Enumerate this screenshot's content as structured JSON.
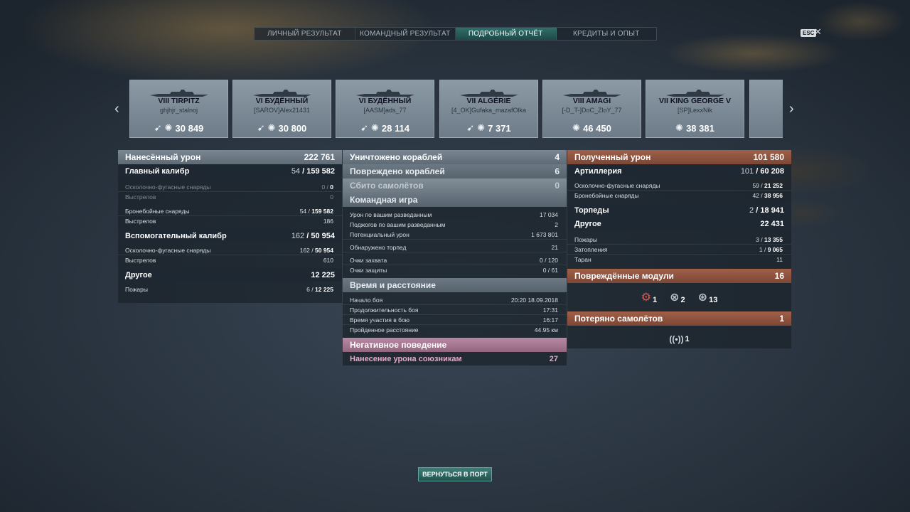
{
  "tabs": [
    {
      "label": "ЛИЧНЫЙ РЕЗУЛЬТАТ",
      "active": false
    },
    {
      "label": "КОМАНДНЫЙ РЕЗУЛЬТАТ",
      "active": false
    },
    {
      "label": "ПОДРОБНЫЙ ОТЧЁТ",
      "active": true
    },
    {
      "label": "КРЕДИТЫ И ОПЫТ",
      "active": false
    }
  ],
  "close": {
    "esc": "ESC",
    "x": "✕"
  },
  "ships": [
    {
      "name": "VIII TIRPITZ",
      "player": "ghjhjr_stalnoj",
      "value": "30 849",
      "torpedo": true
    },
    {
      "name": "VI БУДЁННЫЙ",
      "player": "[SAROV]Alex21431",
      "value": "30 800",
      "torpedo": true
    },
    {
      "name": "VI БУДЁННЫЙ",
      "player": "[AASM]ads_77",
      "value": "28 114",
      "torpedo": true
    },
    {
      "name": "VII ALGÉRIE",
      "player": "[4_OK]Gufaka_mazafOlka",
      "value": "7 371",
      "torpedo": true
    },
    {
      "name": "VIII AMAGI",
      "player": "[-D_T-]DoC_ZloY_77",
      "value": "46 450",
      "torpedo": false
    },
    {
      "name": "VII KING GEORGE V",
      "player": "[SP]LexxNik",
      "value": "38 381",
      "torpedo": false
    }
  ],
  "left": {
    "header": {
      "label": "Нанесённый урон",
      "value": "222 761"
    },
    "main_caliber": {
      "label": "Главный калибр",
      "v1": "54",
      "v2": "159 582"
    },
    "he_shells": {
      "label": "Осколочно-фугасные снаряды",
      "v1": "0",
      "v2": "0"
    },
    "he_shots": {
      "label": "Выстрелов",
      "value": "0"
    },
    "ap_shells": {
      "label": "Бронебойные снаряды",
      "v1": "54",
      "v2": "159 582"
    },
    "ap_shots": {
      "label": "Выстрелов",
      "value": "186"
    },
    "secondary": {
      "label": "Вспомогательный калибр",
      "v1": "162",
      "v2": "50 954"
    },
    "sec_he": {
      "label": "Осколочно-фугасные снаряды",
      "v1": "162",
      "v2": "50 954"
    },
    "sec_shots": {
      "label": "Выстрелов",
      "value": "610"
    },
    "other": {
      "label": "Другое",
      "value": "12 225"
    },
    "fires": {
      "label": "Пожары",
      "v1": "6",
      "v2": "12 225"
    }
  },
  "middle": {
    "destroyed": {
      "label": "Уничтожено кораблей",
      "value": "4"
    },
    "damaged": {
      "label": "Повреждено кораблей",
      "value": "6"
    },
    "planes": {
      "label": "Сбито самолётов",
      "value": "0"
    },
    "team": {
      "label": "Командная игра",
      "rows": [
        {
          "label": "Урон по вашим разведанным",
          "value": "17 034"
        },
        {
          "label": "Поджогов по вашим разведанным",
          "value": "2"
        },
        {
          "label": "Потенциальный урон",
          "value": "1 673 801"
        },
        {
          "label": "Обнаружено торпед",
          "value": "21"
        },
        {
          "label": "Очки захвата",
          "value": "0 / 120"
        },
        {
          "label": "Очки защиты",
          "value": "0 / 61"
        }
      ]
    },
    "time": {
      "label": "Время и расстояние",
      "rows": [
        {
          "label": "Начало боя",
          "value": "20:20  18.09.2018"
        },
        {
          "label": "Продолжительность боя",
          "value": "17:31"
        },
        {
          "label": "Время участия в бою",
          "value": "16:17"
        },
        {
          "label": "Пройденное расстояние",
          "value": "44.95 км"
        }
      ]
    },
    "negative": {
      "label": "Негативное поведение",
      "row_label": "Нанесение урона союзникам",
      "row_value": "27"
    }
  },
  "right": {
    "header": {
      "label": "Полученный урон",
      "value": "101 580"
    },
    "artillery": {
      "label": "Артиллерия",
      "v1": "101",
      "v2": "60 208"
    },
    "he": {
      "label": "Осколочно-фугасные снаряды",
      "v1": "59",
      "v2": "21 252"
    },
    "ap": {
      "label": "Бронебойные снаряды",
      "v1": "42",
      "v2": "38 956"
    },
    "torpedoes": {
      "label": "Торпеды",
      "v1": "2",
      "v2": "18 941"
    },
    "other": {
      "label": "Другое",
      "value": "22 431"
    },
    "fires": {
      "label": "Пожары",
      "v1": "3",
      "v2": "13 355"
    },
    "flooding": {
      "label": "Затопления",
      "v1": "1",
      "v2": "9 065"
    },
    "ram": {
      "label": "Таран",
      "value": "11"
    },
    "modules": {
      "label": "Повреждённые модули",
      "value": "16",
      "items": [
        {
          "icon": "damaged-engine-icon",
          "count": "1"
        },
        {
          "icon": "destroyed-gun-icon",
          "count": "2"
        },
        {
          "icon": "destroyed-aa-icon",
          "count": "13"
        }
      ]
    },
    "planes_lost": {
      "label": "Потеряно самолётов",
      "value": "1",
      "item_count": "1"
    }
  },
  "button": {
    "return_port": "ВЕРНУТЬСЯ В ПОРТ"
  }
}
